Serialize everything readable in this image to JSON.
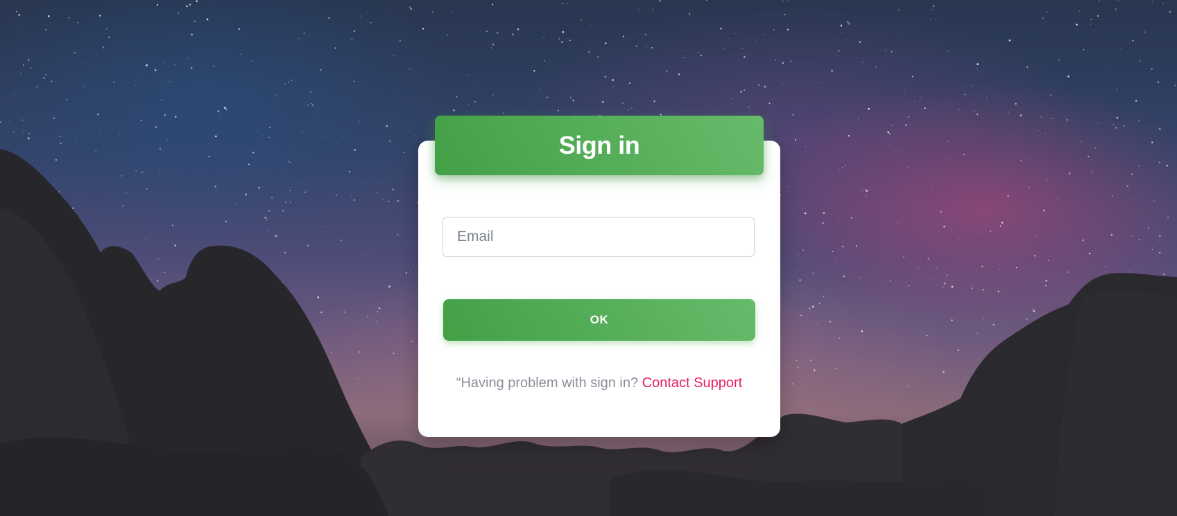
{
  "signin": {
    "title": "Sign in",
    "email_placeholder": "Email",
    "email_value": "",
    "ok_label": "OK",
    "help_text": "“Having problem with sign in?",
    "help_link": "Contact Support"
  },
  "colors": {
    "header_green_start": "#43a047",
    "header_green_end": "#66bb6a",
    "link_pink": "#e91e63",
    "card_bg": "#ffffff"
  }
}
